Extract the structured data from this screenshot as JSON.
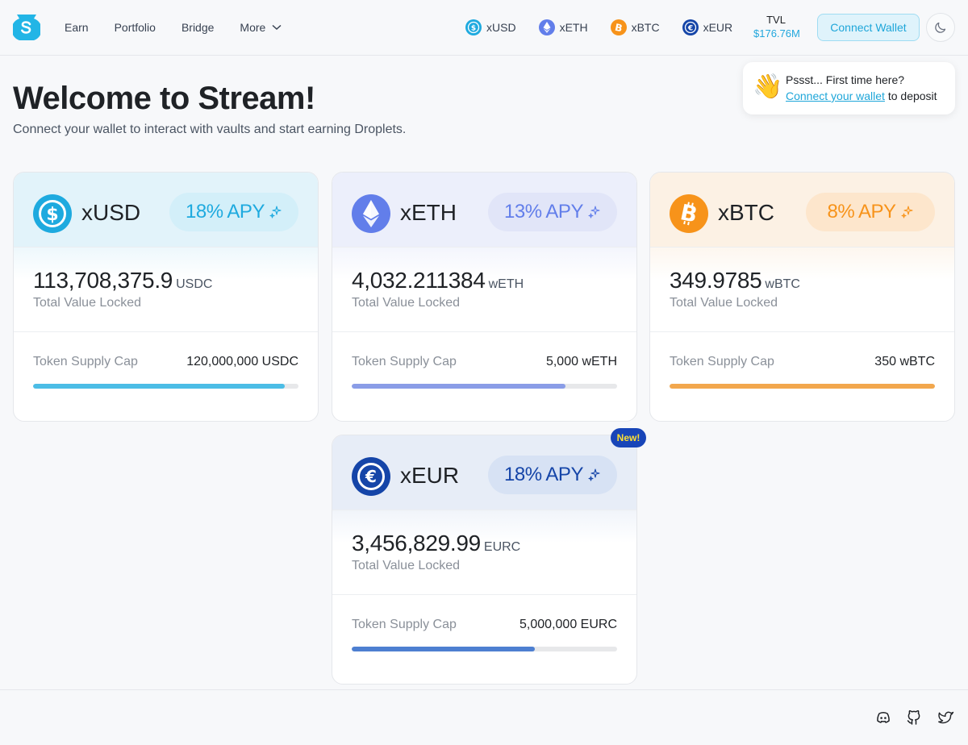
{
  "header": {
    "nav": [
      {
        "label": "Earn"
      },
      {
        "label": "Portfolio"
      },
      {
        "label": "Bridge"
      },
      {
        "label": "More"
      }
    ],
    "tokens": [
      {
        "label": "xUSD",
        "icon": "usdc-icon",
        "color": "#1eaadf"
      },
      {
        "label": "xETH",
        "icon": "eth-icon",
        "color": "#627eea"
      },
      {
        "label": "xBTC",
        "icon": "btc-icon",
        "color": "#f7931a"
      },
      {
        "label": "xEUR",
        "icon": "eurc-icon",
        "color": "#1545a8"
      }
    ],
    "tvl_label": "TVL",
    "tvl_value": "$176.76M",
    "connect_label": "Connect Wallet"
  },
  "tooltip": {
    "emoji": "👋",
    "line1": "Pssst... First time here?",
    "link": "Connect your wallet",
    "line2_rest": "to deposit"
  },
  "hero": {
    "title": "Welcome to Stream!",
    "subtitle": "Connect your wallet to interact with vaults and start earning Droplets."
  },
  "vaults": [
    {
      "name": "xUSD",
      "apy": "18% APY",
      "tvl": "113,708,375.9",
      "unit": "USDC",
      "tvl_label": "Total Value Locked",
      "cap_label": "Token Supply Cap",
      "cap": "120,000,000 USDC",
      "fill_pct": 94.76,
      "accent": "#1eaadf",
      "bar_color": "#4cbde6",
      "tint": "#e2f3fa",
      "apy_bg": "#d3eff9"
    },
    {
      "name": "xETH",
      "apy": "13% APY",
      "tvl": "4,032.211384",
      "unit": "wETH",
      "tvl_label": "Total Value Locked",
      "cap_label": "Token Supply Cap",
      "cap": "5,000 wETH",
      "fill_pct": 80.64,
      "accent": "#627eea",
      "bar_color": "#8a9de7",
      "tint": "#eceffb",
      "apy_bg": "#e1e5f8"
    },
    {
      "name": "xBTC",
      "apy": "8% APY",
      "tvl": "349.9785",
      "unit": "wBTC",
      "tvl_label": "Total Value Locked",
      "cap_label": "Token Supply Cap",
      "cap": "350 wBTC",
      "fill_pct": 99.99,
      "accent": "#f7931a",
      "bar_color": "#f2a74d",
      "tint": "#fcf1e4",
      "apy_bg": "#fde6cc"
    },
    {
      "name": "xEUR",
      "apy": "18% APY",
      "tvl": "3,456,829.99",
      "unit": "EURC",
      "tvl_label": "Total Value Locked",
      "cap_label": "Token Supply Cap",
      "cap": "5,000,000 EURC",
      "fill_pct": 69.14,
      "accent": "#1545a8",
      "bar_color": "#4d7fd1",
      "tint": "#e7edf7",
      "apy_bg": "#d7e2f4",
      "badge": "New!"
    }
  ],
  "footer": {
    "icons": [
      "discord-icon",
      "github-icon",
      "twitter-icon"
    ]
  }
}
